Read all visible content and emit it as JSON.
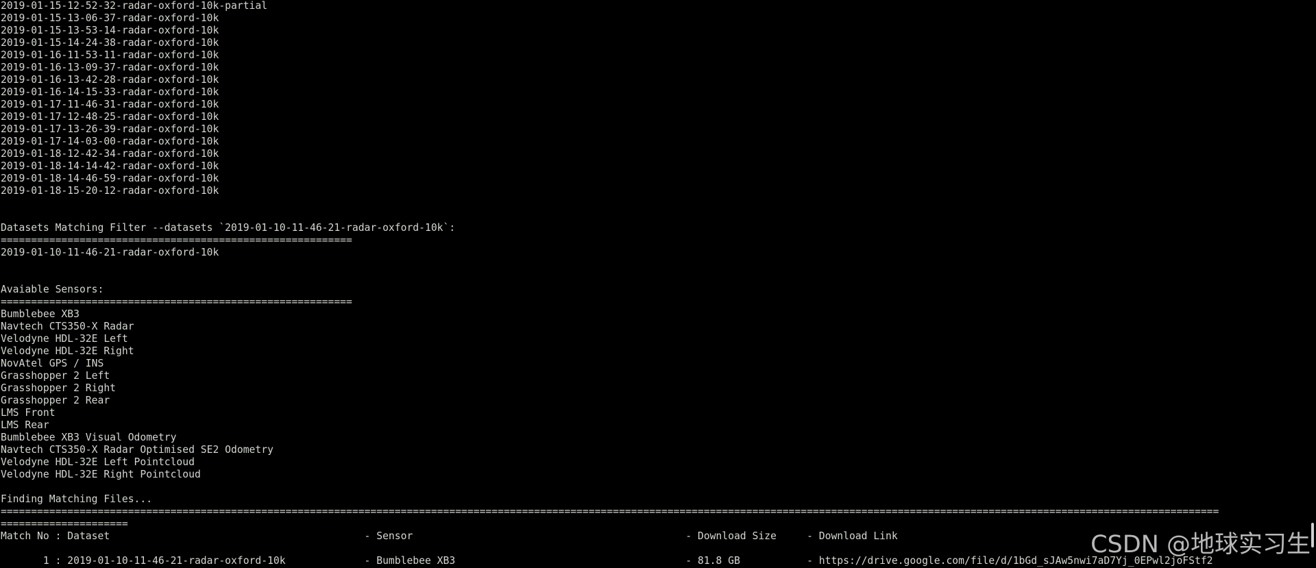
{
  "colors": {
    "background": "#000000",
    "foreground": "#d3d7cf",
    "watermark": "#ffffff"
  },
  "terminal": {
    "lines": [
      "2019-01-15-12-52-32-radar-oxford-10k-partial",
      "2019-01-15-13-06-37-radar-oxford-10k",
      "2019-01-15-13-53-14-radar-oxford-10k",
      "2019-01-15-14-24-38-radar-oxford-10k",
      "2019-01-16-11-53-11-radar-oxford-10k",
      "2019-01-16-13-09-37-radar-oxford-10k",
      "2019-01-16-13-42-28-radar-oxford-10k",
      "2019-01-16-14-15-33-radar-oxford-10k",
      "2019-01-17-11-46-31-radar-oxford-10k",
      "2019-01-17-12-48-25-radar-oxford-10k",
      "2019-01-17-13-26-39-radar-oxford-10k",
      "2019-01-17-14-03-00-radar-oxford-10k",
      "2019-01-18-12-42-34-radar-oxford-10k",
      "2019-01-18-14-14-42-radar-oxford-10k",
      "2019-01-18-14-46-59-radar-oxford-10k",
      "2019-01-18-15-20-12-radar-oxford-10k",
      "",
      "",
      "Datasets Matching Filter --datasets `2019-01-10-11-46-21-radar-oxford-10k`:",
      "==========================================================",
      "2019-01-10-11-46-21-radar-oxford-10k",
      "",
      "",
      "Avaiable Sensors:",
      "==========================================================",
      "Bumblebee XB3",
      "Navtech CTS350-X Radar",
      "Velodyne HDL-32E Left",
      "Velodyne HDL-32E Right",
      "NovAtel GPS / INS",
      "Grasshopper 2 Left",
      "Grasshopper 2 Right",
      "Grasshopper 2 Rear",
      "LMS Front",
      "LMS Rear",
      "Bumblebee XB3 Visual Odometry",
      "Navtech CTS350-X Radar Optimised SE2 Odometry",
      "Velodyne HDL-32E Left Pointcloud",
      "Velodyne HDL-32E Right Pointcloud",
      "",
      "Finding Matching Files...",
      "=========================================================================================================================================================================================================",
      "=====================",
      "Match No : Dataset                                          - Sensor                                             - Download Size     - Download Link",
      "",
      "       1 : 2019-01-10-11-46-21-radar-oxford-10k             - Bumblebee XB3                                      - 81.8 GB           - https://drive.google.com/file/d/1bGd_sJAw5nwi7aD7Yj_0EPwl2joFStf2"
    ]
  },
  "watermark": {
    "text": "CSDN @地球实习生"
  }
}
